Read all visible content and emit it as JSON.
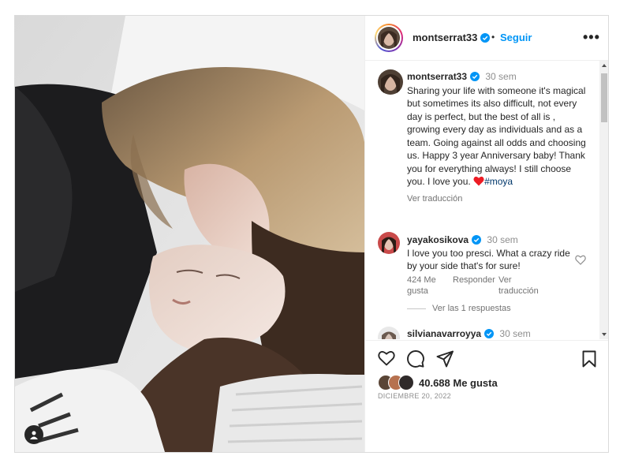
{
  "header": {
    "username": "montserrat33",
    "separator": "•",
    "follow_label": "Seguir",
    "more_label": "•••"
  },
  "caption": {
    "username": "montserrat33",
    "time": "30 sem",
    "text": "Sharing your life with someone it's magical but sometimes its also difficult, not every day is perfect, but the best of all is , growing every day as individuals and as a team. Going against all odds and choosing us. Happy 3 year Anniversary baby! Thank you for everything always! I still choose you. I love you.",
    "hashtag": "#moya",
    "see_translation": "Ver traducción"
  },
  "comments": [
    {
      "username": "yayakosikova",
      "time": "30 sem",
      "text": "I love you too presci. What a crazy ride by your side that's for sure!",
      "likes": "424 Me gusta",
      "reply": "Responder",
      "translate": "Ver traducción",
      "view_replies": "Ver las 1 respuestas"
    },
    {
      "username": "silvianavarroyya",
      "time": "30 sem"
    }
  ],
  "likes": {
    "count_text": "40.688 Me gusta"
  },
  "date": "DICIEMBRE 20, 2022",
  "icons": {
    "like": "heart-icon",
    "comment": "comment-icon",
    "share": "share-icon",
    "save": "bookmark-icon",
    "tag": "user-tag-icon",
    "verified": "verified-badge-icon"
  },
  "colors": {
    "accent": "#0095f6",
    "verified": "#0095f6",
    "heart": "#ed1c24",
    "hashtag": "#00376b"
  }
}
